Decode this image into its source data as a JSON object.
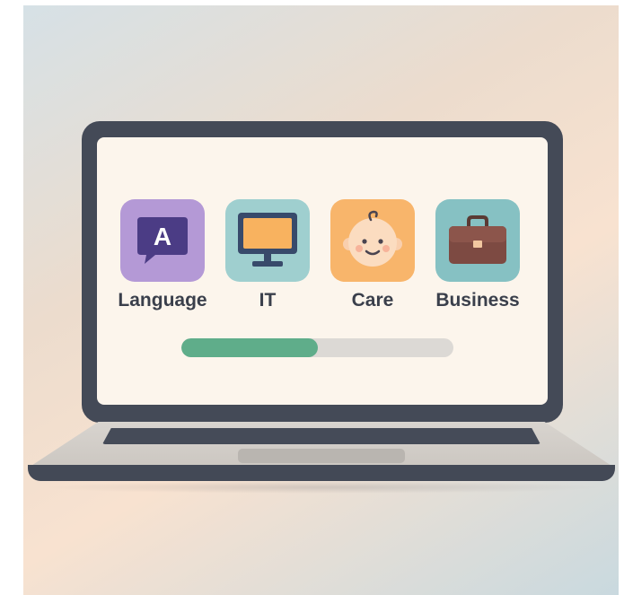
{
  "categories": [
    {
      "label": "Language",
      "icon": "language-icon",
      "glyph": "A",
      "color": "#b499d6"
    },
    {
      "label": "IT",
      "icon": "monitor-icon",
      "color": "#9fcfcf"
    },
    {
      "label": "Care",
      "icon": "baby-face-icon",
      "color": "#f8b56b"
    },
    {
      "label": "Business",
      "icon": "briefcase-icon",
      "color": "#86c1c3"
    }
  ],
  "progress": {
    "value": 0.5,
    "fill_color": "#5fad8a",
    "track_color": "#dcd9d5"
  }
}
